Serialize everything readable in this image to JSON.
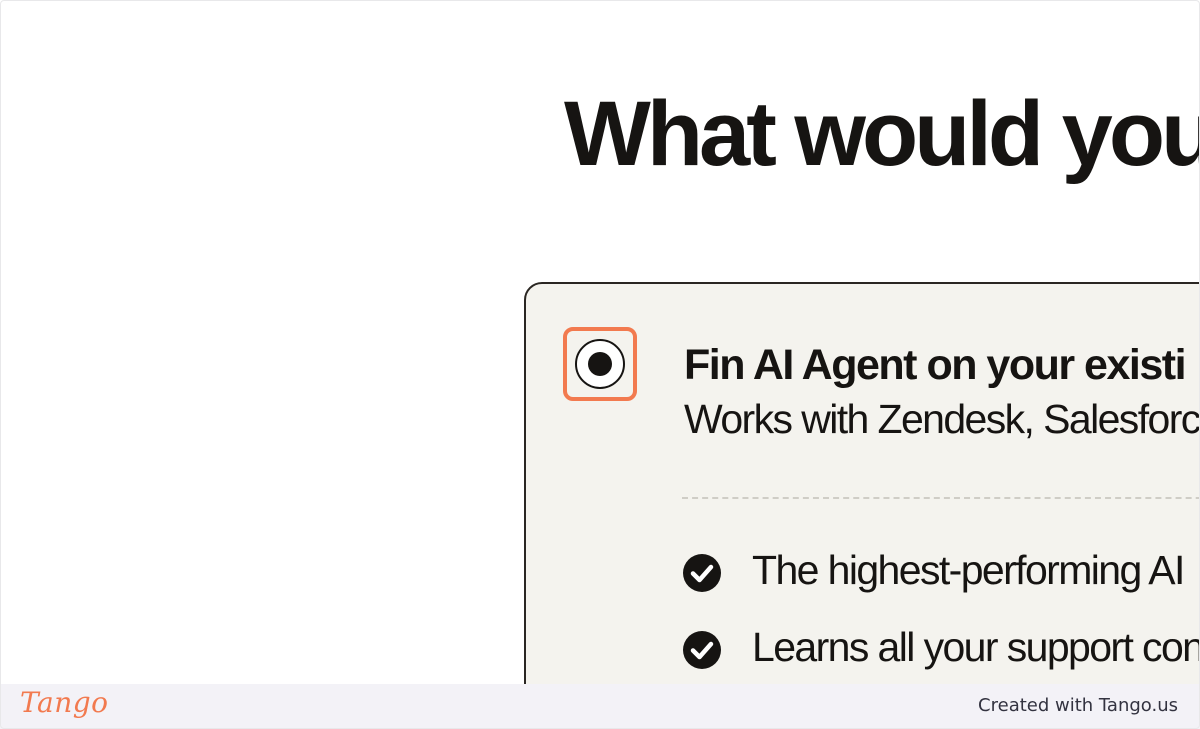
{
  "headline": "What would you",
  "option": {
    "title": "Fin AI Agent on your existi",
    "subtitle": "Works with Zendesk, Salesforc",
    "selected": true,
    "features": [
      "The highest-performing AI",
      "Learns all your support con"
    ]
  },
  "icons": {
    "radio": "radio-selected-icon",
    "check": "check-circle-icon"
  },
  "colors": {
    "highlight": "#f27a4f",
    "text": "#161412",
    "card_background": "#f4f3ee",
    "footer_background": "#f3f2f7"
  },
  "footer": {
    "logo_text": "Tango",
    "credit": "Created with Tango.us"
  }
}
